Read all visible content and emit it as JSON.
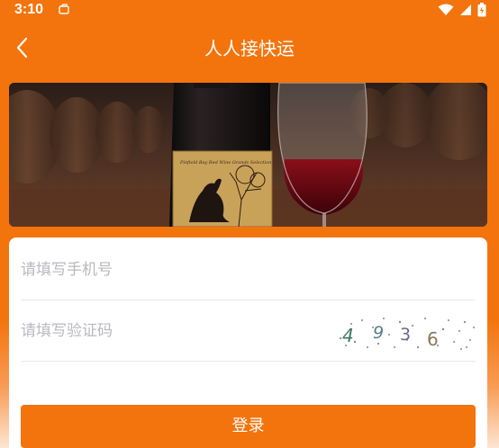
{
  "status_bar": {
    "time": "3:10",
    "icons": [
      "notification-icon",
      "wifi-icon",
      "signal-icon",
      "battery-icon"
    ]
  },
  "header": {
    "title": "人人接快运",
    "back_icon": "chevron-left-icon"
  },
  "banner": {
    "bottle_label_text": "Pinfield Bay Red Wine Grands Selection"
  },
  "form": {
    "phone_placeholder": "请填写手机号",
    "code_placeholder": "请填写验证码",
    "captcha_digits": [
      "4",
      "9",
      "3",
      "6"
    ],
    "login_label": "登录"
  },
  "colors": {
    "accent": "#f3740d",
    "placeholder": "#b8b8c0"
  }
}
